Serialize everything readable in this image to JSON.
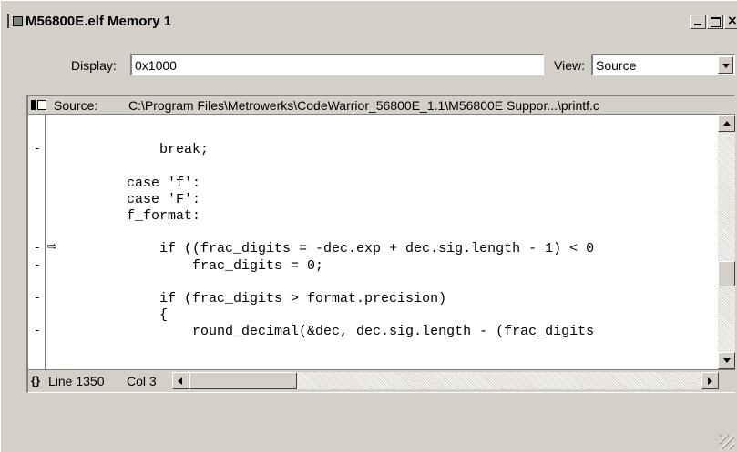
{
  "window": {
    "title": "M56800E.elf Memory 1"
  },
  "controls": {
    "display_label": "Display:",
    "display_value": "0x1000",
    "view_label": "View:",
    "view_value": "Source"
  },
  "source_bar": {
    "label": "Source:",
    "path": "C:\\Program Files\\Metrowerks\\CodeWarrior_56800E_1.1\\M56800E Suppor...\\printf.c"
  },
  "code": {
    "lines": [
      {
        "text": "",
        "bp": ""
      },
      {
        "text": "            break;",
        "bp": "-"
      },
      {
        "text": "",
        "bp": ""
      },
      {
        "text": "        case 'f':",
        "bp": ""
      },
      {
        "text": "        case 'F':",
        "bp": ""
      },
      {
        "text": "        f_format:",
        "bp": ""
      },
      {
        "text": "",
        "bp": ""
      },
      {
        "text": "            if ((frac_digits = -dec.exp + dec.sig.length - 1) < 0",
        "bp": "-",
        "current": true
      },
      {
        "text": "                frac_digits = 0;",
        "bp": "-"
      },
      {
        "text": "",
        "bp": ""
      },
      {
        "text": "            if (frac_digits > format.precision)",
        "bp": "-"
      },
      {
        "text": "            {",
        "bp": ""
      },
      {
        "text": "                round_decimal(&dec, dec.sig.length - (frac_digits",
        "bp": "-"
      },
      {
        "text": "",
        "bp": ""
      }
    ]
  },
  "status": {
    "braces": "{}",
    "line": "Line 1350",
    "col": "Col 3"
  }
}
